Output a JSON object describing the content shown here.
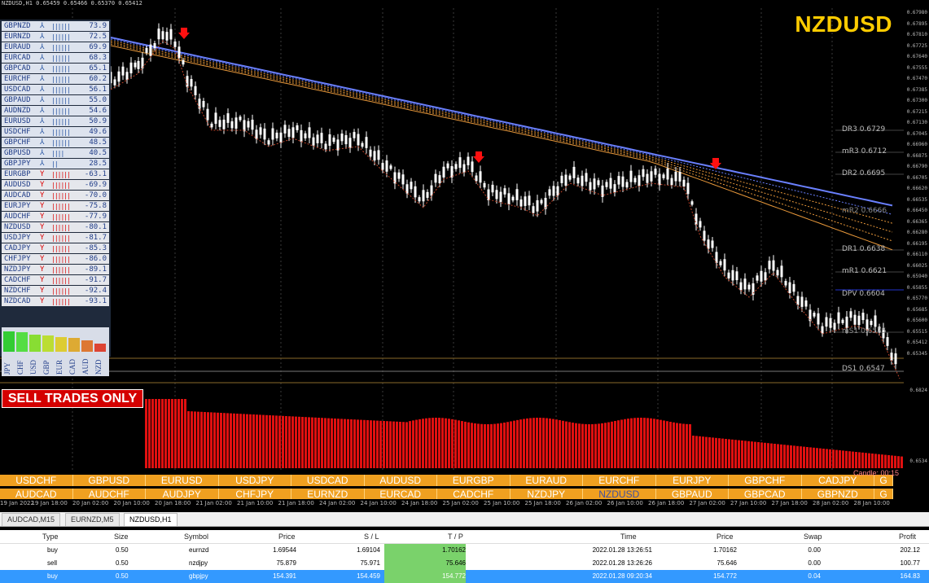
{
  "window": {
    "title": "NZDUSD,H1  0.65459 0.65466 0.65370 0.65412",
    "pair_label": "NZDUSD"
  },
  "strength_table": [
    {
      "sym": "GBPNZD",
      "arrow": "⅄",
      "bars": "||||||",
      "value": "73.9",
      "dir": "pos"
    },
    {
      "sym": "EURNZD",
      "arrow": "⅄",
      "bars": "||||||",
      "value": "72.5",
      "dir": "pos"
    },
    {
      "sym": "EURAUD",
      "arrow": "⅄",
      "bars": "||||||",
      "value": "69.9",
      "dir": "pos"
    },
    {
      "sym": "EURCAD",
      "arrow": "⅄",
      "bars": "||||||",
      "value": "68.3",
      "dir": "pos"
    },
    {
      "sym": "GBPCAD",
      "arrow": "⅄",
      "bars": "||||||",
      "value": "65.1",
      "dir": "pos"
    },
    {
      "sym": "EURCHF",
      "arrow": "⅄",
      "bars": "||||||",
      "value": "60.2",
      "dir": "pos"
    },
    {
      "sym": "USDCAD",
      "arrow": "⅄",
      "bars": "||||||",
      "value": "56.1",
      "dir": "pos"
    },
    {
      "sym": "GBPAUD",
      "arrow": "⅄",
      "bars": "||||||",
      "value": "55.0",
      "dir": "pos"
    },
    {
      "sym": "AUDNZD",
      "arrow": "⅄",
      "bars": "||||||",
      "value": "54.6",
      "dir": "pos"
    },
    {
      "sym": "EURUSD",
      "arrow": "⅄",
      "bars": "||||||",
      "value": "50.9",
      "dir": "pos"
    },
    {
      "sym": "USDCHF",
      "arrow": "⅄",
      "bars": "||||||",
      "value": "49.6",
      "dir": "pos"
    },
    {
      "sym": "GBPCHF",
      "arrow": "⅄",
      "bars": "||||||",
      "value": "48.5",
      "dir": "pos"
    },
    {
      "sym": "GBPUSD",
      "arrow": "⅄",
      "bars": "||||",
      "value": "40.5",
      "dir": "pos"
    },
    {
      "sym": "GBPJPY",
      "arrow": "⅄",
      "bars": "||",
      "value": "28.5",
      "dir": "pos"
    },
    {
      "sym": "EURGBP",
      "arrow": "Y",
      "bars": "||||||",
      "value": "-63.1",
      "dir": "neg"
    },
    {
      "sym": "AUDUSD",
      "arrow": "Y",
      "bars": "||||||",
      "value": "-69.9",
      "dir": "neg"
    },
    {
      "sym": "AUDCAD",
      "arrow": "Y",
      "bars": "||||||",
      "value": "-70.0",
      "dir": "neg"
    },
    {
      "sym": "EURJPY",
      "arrow": "Y",
      "bars": "||||||",
      "value": "-75.8",
      "dir": "neg"
    },
    {
      "sym": "AUDCHF",
      "arrow": "Y",
      "bars": "||||||",
      "value": "-77.9",
      "dir": "neg"
    },
    {
      "sym": "NZDUSD",
      "arrow": "Y",
      "bars": "||||||",
      "value": "-80.1",
      "dir": "neg"
    },
    {
      "sym": "USDJPY",
      "arrow": "Y",
      "bars": "||||||",
      "value": "-81.7",
      "dir": "neg"
    },
    {
      "sym": "CADJPY",
      "arrow": "Y",
      "bars": "||||||",
      "value": "-85.3",
      "dir": "neg"
    },
    {
      "sym": "CHFJPY",
      "arrow": "Y",
      "bars": "||||||",
      "value": "-86.0",
      "dir": "neg"
    },
    {
      "sym": "NZDJPY",
      "arrow": "Y",
      "bars": "||||||",
      "value": "-89.1",
      "dir": "neg"
    },
    {
      "sym": "CADCHF",
      "arrow": "Y",
      "bars": "||||||",
      "value": "-91.7",
      "dir": "neg"
    },
    {
      "sym": "NZDCHF",
      "arrow": "Y",
      "bars": "||||||",
      "value": "-92.4",
      "dir": "neg"
    },
    {
      "sym": "NZDCAD",
      "arrow": "Y",
      "bars": "||||||",
      "value": "-93.1",
      "dir": "neg"
    }
  ],
  "currency_strength": [
    {
      "ccy": "JPY",
      "level": 0.9,
      "color": "#33cc33"
    },
    {
      "ccy": "CHF",
      "level": 0.85,
      "color": "#55dd44"
    },
    {
      "ccy": "USD",
      "level": 0.75,
      "color": "#88dd33"
    },
    {
      "ccy": "GBP",
      "level": 0.7,
      "color": "#bbdd33"
    },
    {
      "ccy": "EUR",
      "level": 0.65,
      "color": "#ddcc33"
    },
    {
      "ccy": "CAD",
      "level": 0.6,
      "color": "#ddaa33"
    },
    {
      "ccy": "AUD",
      "level": 0.5,
      "color": "#dd7733"
    },
    {
      "ccy": "NZD",
      "level": 0.35,
      "color": "#dd4433"
    }
  ],
  "price_scale": [
    "0.67980",
    "0.67895",
    "0.67810",
    "0.67725",
    "0.67640",
    "0.67555",
    "0.67470",
    "0.67385",
    "0.67300",
    "0.67215",
    "0.67130",
    "0.67045",
    "0.66960",
    "0.66875",
    "0.66790",
    "0.66705",
    "0.66620",
    "0.66535",
    "0.66450",
    "0.66365",
    "0.66280",
    "0.66195",
    "0.66110",
    "0.66025",
    "0.65940",
    "0.65855",
    "0.65770",
    "0.65685",
    "0.65600",
    "0.65515",
    "0.65412",
    "0.65345"
  ],
  "levels": [
    {
      "label": "DR3  0.6729",
      "color": "#bbbbbb"
    },
    {
      "label": "mR3  0.6712",
      "color": "#bbbbbb"
    },
    {
      "label": "DR2  0.6695",
      "color": "#bbbbbb"
    },
    {
      "label": "mR2  0.6666",
      "color": "#888888"
    },
    {
      "label": "DR1  0.6638",
      "color": "#bbbbbb"
    },
    {
      "label": "mR1  0.6621",
      "color": "#bbbbbb"
    },
    {
      "label": "DPV  0.6604",
      "color": "#bbbbbb"
    },
    {
      "label": "mS1  0.6575",
      "color": "#888888"
    },
    {
      "label": "DS1  0.6547",
      "color": "#bbbbbb"
    }
  ],
  "indicator_scale": [
    "0.6824",
    "0.6534"
  ],
  "sell_badge": "SELL TRADES ONLY",
  "pair_buttons_row1": [
    "USDCHF",
    "GBPUSD",
    "EURUSD",
    "USDJPY",
    "USDCAD",
    "AUDUSD",
    "EURGBP",
    "EURAUD",
    "EURCHF",
    "EURJPY",
    "GBPCHF",
    "CADJPY",
    "G"
  ],
  "pair_buttons_row2": [
    "AUDCAD",
    "AUDCHF",
    "AUDJPY",
    "CHFJPY",
    "EURNZD",
    "EURCAD",
    "CADCHF",
    "NZDJPY",
    "NZDUSD",
    "GBPAUD",
    "GBPCAD",
    "GBPNZD",
    "G"
  ],
  "candle_timer": "Candle: 00:15",
  "time_axis": [
    "19 Jan 2022",
    "19 Jan 18:00",
    "20 Jan 02:00",
    "20 Jan 10:00",
    "20 Jan 18:00",
    "21 Jan 02:00",
    "21 Jan 10:00",
    "21 Jan 18:00",
    "24 Jan 02:00",
    "24 Jan 10:00",
    "24 Jan 18:00",
    "25 Jan 02:00",
    "25 Jan 10:00",
    "25 Jan 18:00",
    "26 Jan 02:00",
    "26 Jan 10:00",
    "26 Jan 18:00",
    "27 Jan 02:00",
    "27 Jan 10:00",
    "27 Jan 18:00",
    "28 Jan 02:00",
    "28 Jan 10:00"
  ],
  "tabs": [
    "AUDCAD,M15",
    "EURNZD,M5",
    "NZDUSD,H1"
  ],
  "table_headers": {
    "type": "Type",
    "size": "Size",
    "symbol": "Symbol",
    "price": "Price",
    "sl": "S / L",
    "tp": "T / P",
    "time": "Time",
    "price2": "Price",
    "swap": "Swap",
    "profit": "Profit"
  },
  "trades": [
    {
      "type": "buy",
      "size": "0.50",
      "symbol": "eurnzd",
      "price": "1.69544",
      "sl": "1.69104",
      "tp": "1.70162",
      "time": "2022.01.28 13:26:51",
      "price2": "1.70162",
      "swap": "0.00",
      "profit": "202.12"
    },
    {
      "type": "sell",
      "size": "0.50",
      "symbol": "nzdjpy",
      "price": "75.879",
      "sl": "75.971",
      "tp": "75.646",
      "time": "2022.01.28 13:26:26",
      "price2": "75.646",
      "swap": "0.00",
      "profit": "100.77"
    },
    {
      "type": "buy",
      "size": "0.50",
      "symbol": "gbpjpy",
      "price": "154.391",
      "sl": "154.459",
      "tp": "154.772",
      "time": "2022.01.28 09:20:34",
      "price2": "154.772",
      "swap": "0.04",
      "profit": "164.83"
    }
  ]
}
